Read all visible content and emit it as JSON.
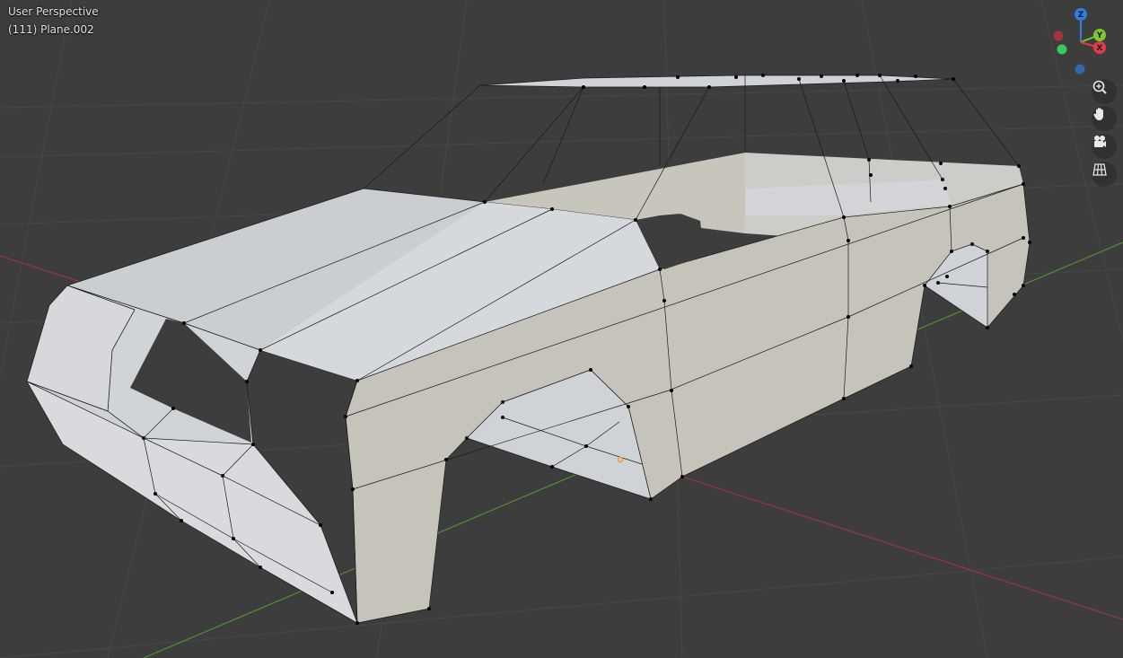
{
  "viewport": {
    "view_name": "User Perspective",
    "object_info": "(111) Plane.002"
  },
  "gizmo": {
    "axes": [
      {
        "label": "Z",
        "color": "#2f7fe0"
      },
      {
        "label": "Y",
        "color": "#7ec72e"
      },
      {
        "label": "X",
        "color": "#e5384f"
      }
    ],
    "negative_axes": [
      {
        "name": "neg-x",
        "color": "#a8313f"
      },
      {
        "name": "neg-y",
        "color": "#3ac85a"
      },
      {
        "name": "neg-z",
        "color": "#3566a8"
      }
    ]
  },
  "nav_buttons": [
    {
      "name": "zoom",
      "icon": "zoom-icon"
    },
    {
      "name": "pan",
      "icon": "hand-icon"
    },
    {
      "name": "camera",
      "icon": "camera-icon"
    },
    {
      "name": "grid-view",
      "icon": "grid-icon"
    }
  ],
  "colors": {
    "background": "#3d3d3d",
    "grid_line": "#4a4a4a",
    "x_axis": "#9b3b3b",
    "y_axis": "#4d8a2e",
    "mesh_light": "#d0d3d8",
    "mesh_warm": "#c9c5bc",
    "vertex": "#000000",
    "active_vertex": "#f29a2c"
  }
}
